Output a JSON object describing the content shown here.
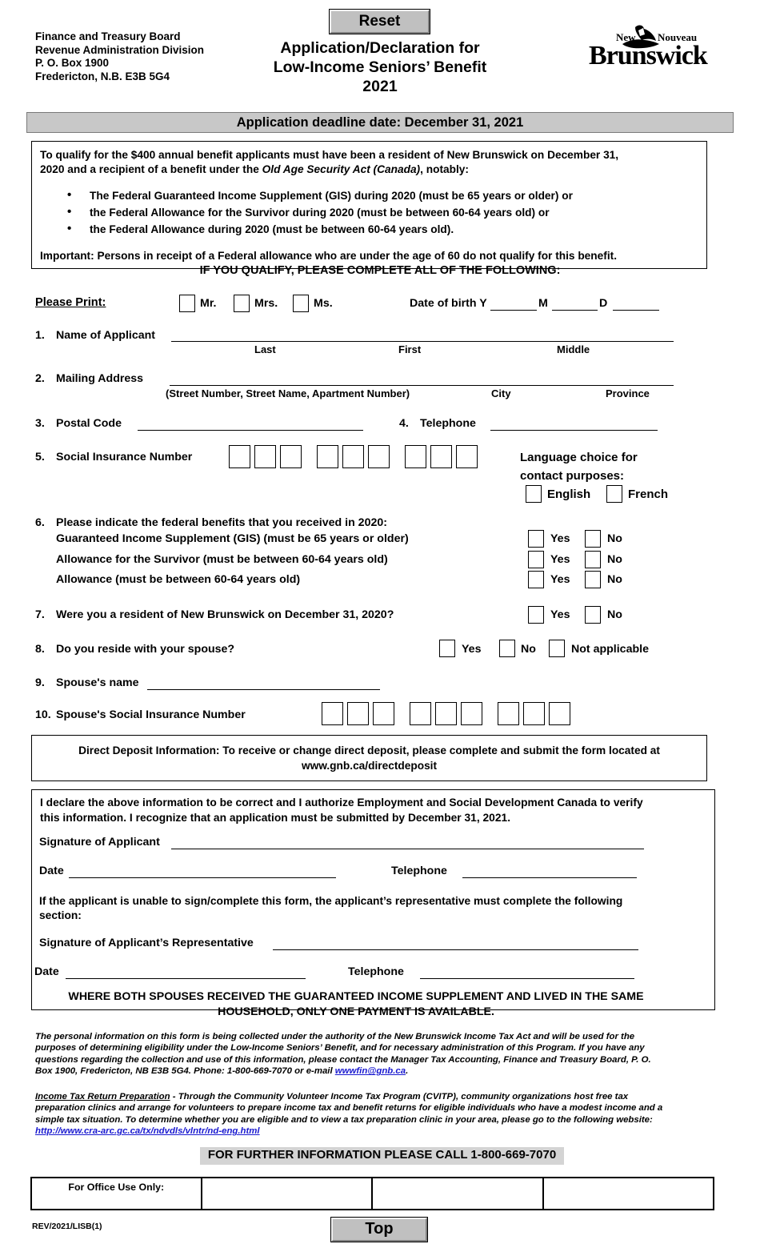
{
  "header": {
    "org_address": "Finance and Treasury Board\nRevenue Administration Division\nP. O. Box 1900\nFredericton, N.B.  E3B 5G4",
    "reset_label": "Reset",
    "title_line1": "Application/Declaration for",
    "title_line2": "Low-Income Seniors’ Benefit",
    "title_line3": "2021",
    "logo": {
      "new": "New",
      "nouveau": "Nouveau",
      "wordmark": "Brunswick"
    }
  },
  "deadline_banner": "Application deadline date:  December 31, 2021",
  "qualify": {
    "intro_line1": "To qualify for the $400 annual benefit applicants must have been a resident of New Brunswick on December 31,",
    "intro_line2_a": "2020 and a recipient of a benefit under the ",
    "intro_line2_italic": "Old Age Security Act (Canada)",
    "intro_line2_b": ", notably:",
    "bullets": [
      "The Federal Guaranteed Income Supplement (GIS) during 2020 (must be 65 years or older) or",
      "the Federal Allowance for the Survivor during 2020 (must be between 60-64 years old) or",
      "the Federal Allowance during 2020 (must be between 60-64 years old)."
    ],
    "important": "Important:  Persons in receipt of a Federal allowance who are under the age of 60 do not qualify for this benefit."
  },
  "if_qualify": "IF YOU QUALIFY, PLEASE COMPLETE ALL OF THE FOLLOWING:",
  "print_row": {
    "please_print": "Please Print:",
    "titles": [
      "Mr.",
      "Mrs.",
      "Ms."
    ],
    "dob_label": "Date of birth Y",
    "dob_m": "M",
    "dob_d": "D"
  },
  "q1": {
    "number": "1.",
    "label": "Name of Applicant",
    "sub_last": "Last",
    "sub_first": "First",
    "sub_middle": "Middle"
  },
  "q2": {
    "number": "2.",
    "label": "Mailing Address",
    "sub_street": "(Street Number, Street Name, Apartment Number)",
    "sub_city": "City",
    "sub_province": "Province"
  },
  "q3": {
    "number": "3.",
    "label": "Postal Code"
  },
  "q4": {
    "number": "4.",
    "label": "Telephone"
  },
  "q5": {
    "number": "5.",
    "label": "Social Insurance Number",
    "box_count": 9
  },
  "language": {
    "heading_line1": "Language choice for",
    "heading_line2": "contact purposes:",
    "english": "English",
    "french": "French"
  },
  "q6": {
    "number": "6.",
    "label": "Please indicate the federal benefits that you received in 2020:",
    "rows": [
      {
        "text": "Guaranteed Income Supplement (GIS) (must be 65 years or older)",
        "yes": "Yes",
        "no": "No"
      },
      {
        "text": "Allowance for the Survivor (must be between 60-64 years old)",
        "yes": "Yes",
        "no": "No"
      },
      {
        "text": "Allowance (must be between 60-64 years old)",
        "yes": "Yes",
        "no": "No"
      }
    ]
  },
  "q7": {
    "number": "7.",
    "label": "Were you a resident of New Brunswick on December 31, 2020?",
    "yes": "Yes",
    "no": "No"
  },
  "q8": {
    "number": "8.",
    "label": "Do you reside with your spouse?",
    "yes": "Yes",
    "no": "No",
    "na": "Not applicable"
  },
  "q9": {
    "number": "9.",
    "label": "Spouse's name"
  },
  "q10": {
    "number": "10.",
    "label": "Spouse's Social Insurance Number",
    "box_count": 9
  },
  "direct_deposit": {
    "line1": "Direct Deposit Information: To receive or change direct deposit, please complete and submit the form located at",
    "line2": "www.gnb.ca/directdeposit"
  },
  "declaration": {
    "line1": "I declare the above information to be correct and I authorize Employment and Social Development Canada to verify",
    "line2": "this information.  I recognize that an application must be submitted by December 31, 2021.",
    "sig_applicant": "Signature of Applicant",
    "date_label": "Date",
    "tel_label": "Telephone",
    "rep_intro_line1": "If the applicant is unable to sign/complete this form, the applicant’s representative must complete the following",
    "rep_intro_line2": "section:",
    "sig_rep": "Signature of Applicant’s Representative",
    "rep_date_label": "Date",
    "rep_tel_label": "Telephone"
  },
  "both_spouses_note_line1": "WHERE BOTH SPOUSES RECEIVED THE GUARANTEED INCOME SUPPLEMENT AND LIVED IN THE SAME",
  "both_spouses_note_line2": "HOUSEHOLD, ONLY ONE PAYMENT IS AVAILABLE.",
  "privacy": {
    "line1": "The personal information on this form is being collected under the authority of the New Brunswick Income Tax Act and will be used for the",
    "line2": "purposes of determining eligibility under the Low-Income Seniors’ Benefit, and for necessary administration of this Program. If you have any",
    "line3": "questions regarding the collection and use of this information, please contact the Manager Tax Accounting, Finance and Treasury Board, P. O.",
    "line4_a": "Box 1900, Fredericton, NB E3B 5G4.  Phone:    1-800-669-7070 or e-mail ",
    "email": "wwwfin@gnb.ca",
    "line4_b": "."
  },
  "tax_prep": {
    "heading": "Income Tax Return Preparation",
    "line1_rest": " - Through the Community Volunteer Income Tax Program (CVITP), community organizations host free tax",
    "line2": "preparation clinics and arrange for volunteers to prepare income tax and benefit returns for eligible individuals who have a modest income and a",
    "line3": "simple tax situation. To determine whether you are eligible and to view a tax preparation clinic in your area, please go to the following website:",
    "url": "http://www.cra-arc.gc.ca/tx/ndvdls/vlntr/nd-eng.html"
  },
  "call_banner": "FOR FURTHER INFORMATION PLEASE CALL 1-800-669-7070",
  "office_use": {
    "label": "For Office Use Only:",
    "cells": [
      "",
      "",
      ""
    ]
  },
  "rev_code": "REV/2021/LISB(1)",
  "top_button": "Top",
  "colors": {
    "banner_gray": "#c8c8c8",
    "button_face": "#c0c0c0",
    "link_blue": "#1a1ad0",
    "call_banner_gray": "#d4d4d4"
  }
}
